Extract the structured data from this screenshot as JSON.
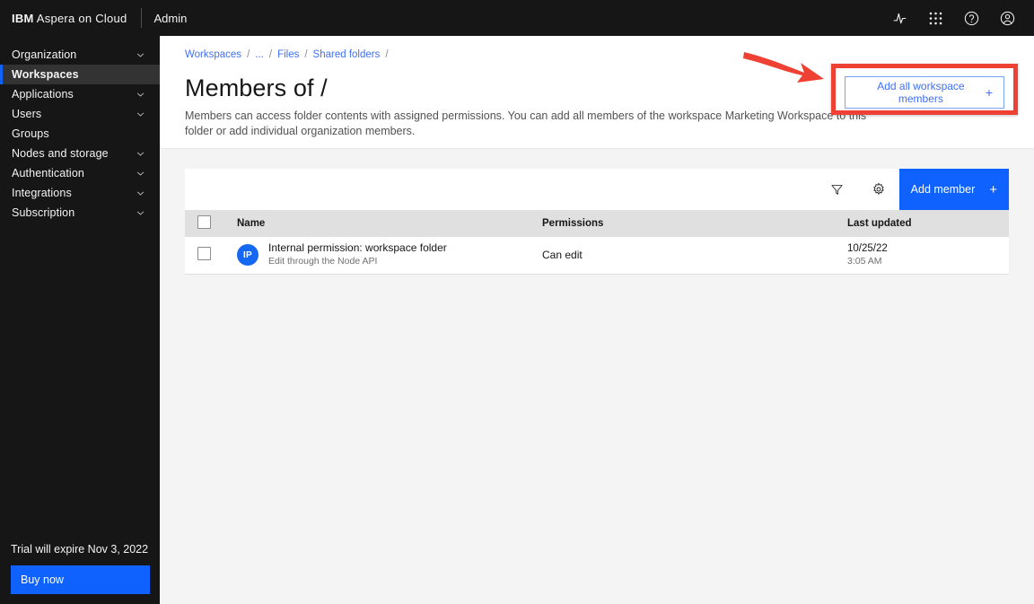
{
  "header": {
    "brand_strong": "IBM",
    "brand_rest": " Aspera on Cloud",
    "admin_label": "Admin",
    "icons": [
      {
        "name": "activity-icon",
        "title": "Activity"
      },
      {
        "name": "app-switcher-icon",
        "title": "Apps"
      },
      {
        "name": "help-icon",
        "title": "Help"
      },
      {
        "name": "account-icon",
        "title": "Account"
      }
    ]
  },
  "sidebar": {
    "items": [
      {
        "label": "Organization",
        "expandable": true,
        "selected": false
      },
      {
        "label": "Workspaces",
        "expandable": false,
        "selected": true
      },
      {
        "label": "Applications",
        "expandable": true,
        "selected": false
      },
      {
        "label": "Users",
        "expandable": true,
        "selected": false
      },
      {
        "label": "Groups",
        "expandable": false,
        "selected": false
      },
      {
        "label": "Nodes and storage",
        "expandable": true,
        "selected": false
      },
      {
        "label": "Authentication",
        "expandable": true,
        "selected": false
      },
      {
        "label": "Integrations",
        "expandable": true,
        "selected": false
      },
      {
        "label": "Subscription",
        "expandable": true,
        "selected": false
      }
    ],
    "trial_text": "Trial will expire Nov 3, 2022",
    "buy_label": "Buy now"
  },
  "breadcrumb": {
    "items": [
      {
        "label": "Workspaces",
        "link": true
      },
      {
        "label": "...",
        "link": true
      },
      {
        "label": "Files",
        "link": true
      },
      {
        "label": "Shared folders",
        "link": true
      }
    ],
    "separator": "/",
    "trailing_separator": "/"
  },
  "page": {
    "title": "Members of /",
    "description": "Members can access folder contents with assigned permissions. You can add all members of the workspace Marketing Workspace to this folder or add individual organization members."
  },
  "toolbar": {
    "filter_icon": "filter-icon",
    "settings_icon": "gear-icon",
    "add_member_label": "Add member",
    "add_member_plus": "+"
  },
  "annotation": {
    "box_color": "#ef4133",
    "arrow_color": "#ef4133",
    "button_label": "Add all workspace members",
    "button_plus": "+",
    "button_accent": "#4070f4"
  },
  "table": {
    "columns": [
      "",
      "Name",
      "Permissions",
      "Last updated"
    ],
    "rows": [
      {
        "selected": false,
        "avatar_initials": "IP",
        "avatar_color": "#1668f3",
        "name": "Internal permission: workspace folder",
        "name_sub": "Edit through the Node API",
        "permissions": "Can edit",
        "updated_date": "10/25/22",
        "updated_time": "3:05 AM"
      }
    ]
  },
  "colors": {
    "brand_blue": "#0f62fe",
    "link_blue": "#4070f4",
    "header_black": "#161616",
    "page_bg": "#f4f4f4",
    "annotation_red": "#ef4133"
  }
}
